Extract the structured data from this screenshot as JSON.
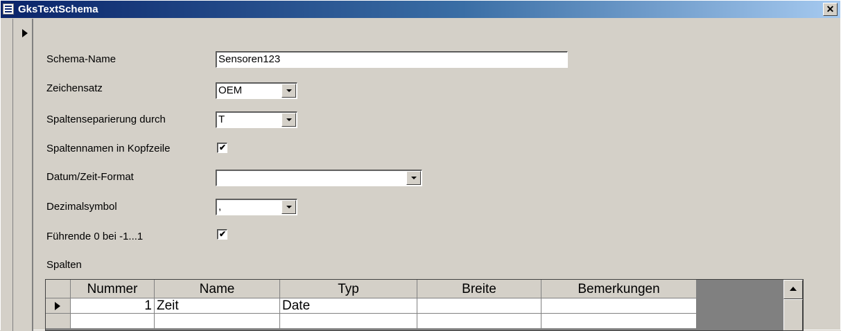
{
  "window": {
    "title": "GksTextSchema"
  },
  "form": {
    "schema_name": {
      "label": "Schema-Name",
      "value": "Sensoren123"
    },
    "charset": {
      "label": "Zeichensatz",
      "value": "OEM"
    },
    "column_separator": {
      "label": "Spaltenseparierung durch",
      "value": "T"
    },
    "header_row": {
      "label": "Spaltennamen in Kopfzeile",
      "checked": true
    },
    "datetime_format": {
      "label": "Datum/Zeit-Format",
      "value": ""
    },
    "decimal_symbol": {
      "label": "Dezimalsymbol",
      "value": ","
    },
    "leading_zero": {
      "label": "Führende 0 bei -1...1",
      "checked": true
    },
    "columns_label": "Spalten"
  },
  "grid": {
    "headers": [
      "Nummer",
      "Name",
      "Typ",
      "Breite",
      "Bemerkungen"
    ],
    "rows": [
      {
        "nummer": "1",
        "name": "Zeit",
        "typ": "Date",
        "breite": "",
        "bemerkungen": ""
      }
    ]
  },
  "icons": {
    "window": "form-icon",
    "close": "close-icon",
    "record_selector": "record-pointer-icon",
    "dropdown": "chevron-down-icon",
    "scroll_up": "scroll-up-arrow-icon"
  }
}
